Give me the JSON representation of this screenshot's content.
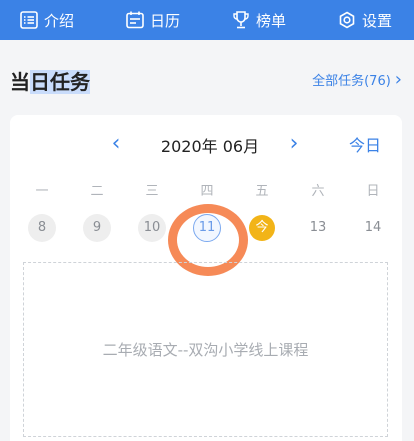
{
  "nav": {
    "items": [
      {
        "label": "介绍",
        "icon": "list-icon"
      },
      {
        "label": "日历",
        "icon": "calendar-icon"
      },
      {
        "label": "榜单",
        "icon": "trophy-icon"
      },
      {
        "label": "设置",
        "icon": "gear-icon"
      }
    ]
  },
  "section": {
    "title_prefix": "当",
    "title_highlight": "日任务",
    "all_tasks_label": "全部任务(76)",
    "all_tasks_chevron": "›"
  },
  "calendar": {
    "prev": "‹",
    "next": "›",
    "month_label": "2020年 06月",
    "today_label": "今日",
    "weekdays": [
      "一",
      "二",
      "三",
      "四",
      "五",
      "六",
      "日"
    ],
    "days": [
      {
        "label": "8",
        "state": "past"
      },
      {
        "label": "9",
        "state": "past"
      },
      {
        "label": "10",
        "state": "past"
      },
      {
        "label": "11",
        "state": "selected"
      },
      {
        "label": "今",
        "state": "today"
      },
      {
        "label": "13",
        "state": "future"
      },
      {
        "label": "14",
        "state": "future"
      }
    ]
  },
  "task": {
    "text": "二年级语文--双沟小学线上课程"
  },
  "colors": {
    "accent": "#3b82e6",
    "today": "#f2b418",
    "annotation": "#f68a57"
  }
}
